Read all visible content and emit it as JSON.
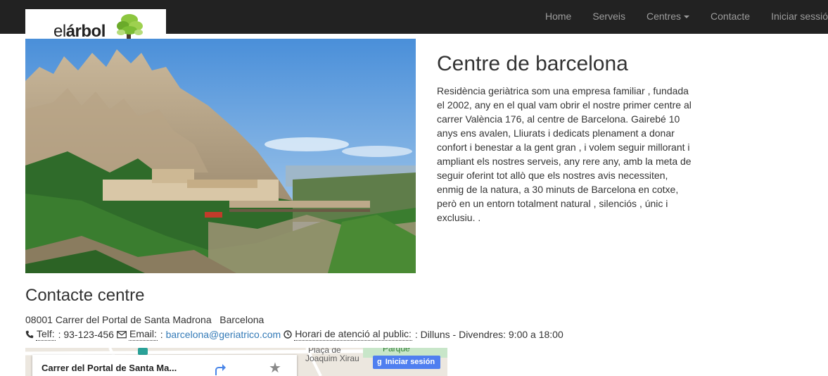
{
  "nav": {
    "items": [
      {
        "label": "Home"
      },
      {
        "label": "Serveis"
      },
      {
        "label": "Centres"
      },
      {
        "label": "Contacte"
      },
      {
        "label": "Iniciar sessió"
      }
    ]
  },
  "logo": {
    "text_prefix": "el",
    "text_bold": "árbol"
  },
  "center": {
    "title": "Centre de barcelona",
    "description": "Residència geriàtrica som una empresa familiar , fundada el 2002, any en el qual vam obrir el nostre primer centre al carrer València 176, al centre de Barcelona. Gairebé 10 anys ens avalen, Lliurats i dedicats plenament a donar confort i benestar a la gent gran , i volem seguir millorant i ampliant els nostres serveis, any rere any, amb la meta de seguir oferint tot allò que els nostres avis necessiten, enmig de la natura, a 30 minuts de Barcelona en cotxe, però en un entorn totalment natural , silenciós , únic i exclusiu. ."
  },
  "contact": {
    "title": "Contacte centre",
    "address": "08001 Carrer del Portal de Santa Madrona   Barcelona",
    "phone_label": "Telf:",
    "phone": "93-123-456",
    "email_label": "Email:",
    "email": "barcelona@geriatrico.com",
    "hours_label": "Horari de atenció al public:",
    "hours": "Dilluns - Divendres: 9:00 a 18:00"
  },
  "map": {
    "place_name": "Carrer del Portal de Santa Ma...",
    "login_button": "Iniciar sesión",
    "labels": [
      "Plaça de",
      "Joaquim Xirau",
      "Parque"
    ]
  },
  "colors": {
    "navbar": "#222222",
    "nav_text": "#9d9d9d",
    "link": "#337ab7",
    "text": "#333333",
    "map_button": "#4f7ff0"
  },
  "icons": [
    "tree-logo-icon",
    "caret-down-icon",
    "phone-icon",
    "envelope-icon",
    "clock-icon",
    "directions-icon",
    "star-icon",
    "google-g-icon"
  ]
}
